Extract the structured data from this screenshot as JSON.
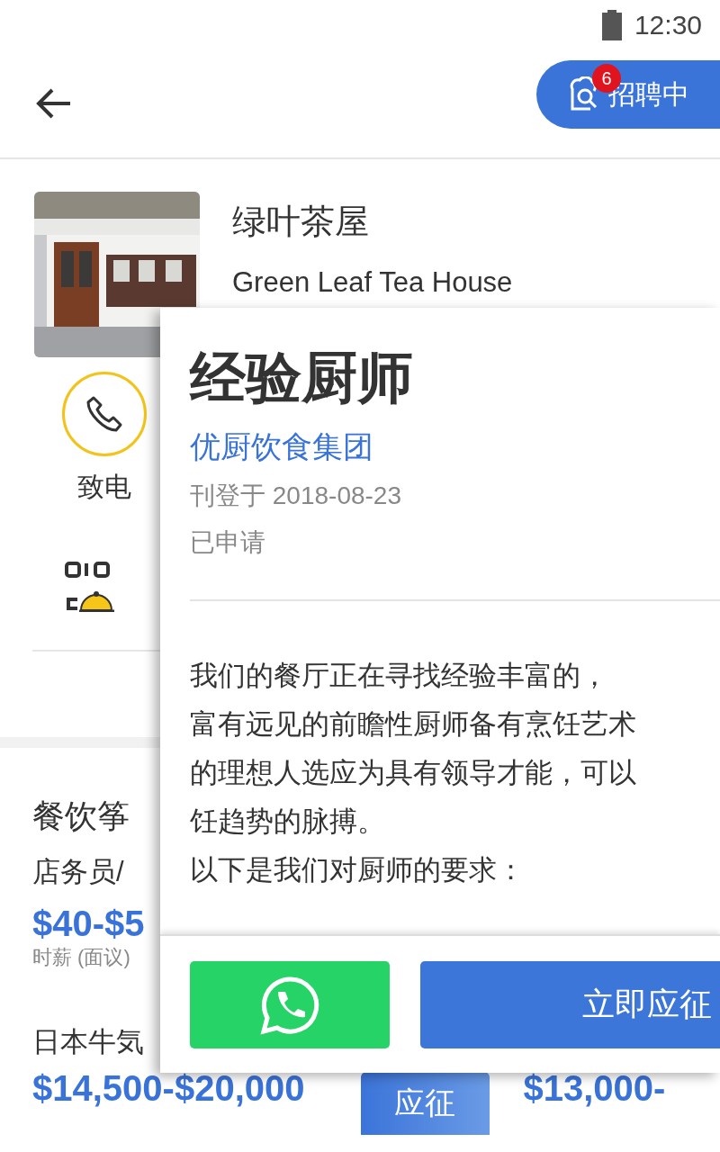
{
  "status_bar": {
    "time": "12:30"
  },
  "header": {
    "recruit_button": {
      "label": "招聘中",
      "badge": "6"
    }
  },
  "store": {
    "name": "绿叶茶屋",
    "name_en": "Green Leaf Tea House"
  },
  "actions": [
    {
      "label": "致电"
    }
  ],
  "jobs_section": {
    "title": "餐饮筝",
    "jobs": [
      {
        "title": "店务员/",
        "salary": "$40-$5",
        "salary_note": "时薪 (面议)"
      },
      {
        "title": "日本牛気",
        "salary": "$14,500-$20,000",
        "apply": "应征"
      }
    ],
    "next_salary": "$13,000-"
  },
  "job_detail": {
    "title": "经验厨师",
    "company": "优厨饮食集团",
    "posted": "刊登于 2018-08-23",
    "status": "已申请",
    "description": [
      "我们的餐厅正在寻找经验丰富的，",
      "富有远见的前瞻性厨师备有烹饪艺术",
      "的理想人选应为具有领导才能，可以",
      "饪趋势的脉搏。",
      "以下是我们对厨师的要求："
    ],
    "apply_button": "立即应征"
  }
}
